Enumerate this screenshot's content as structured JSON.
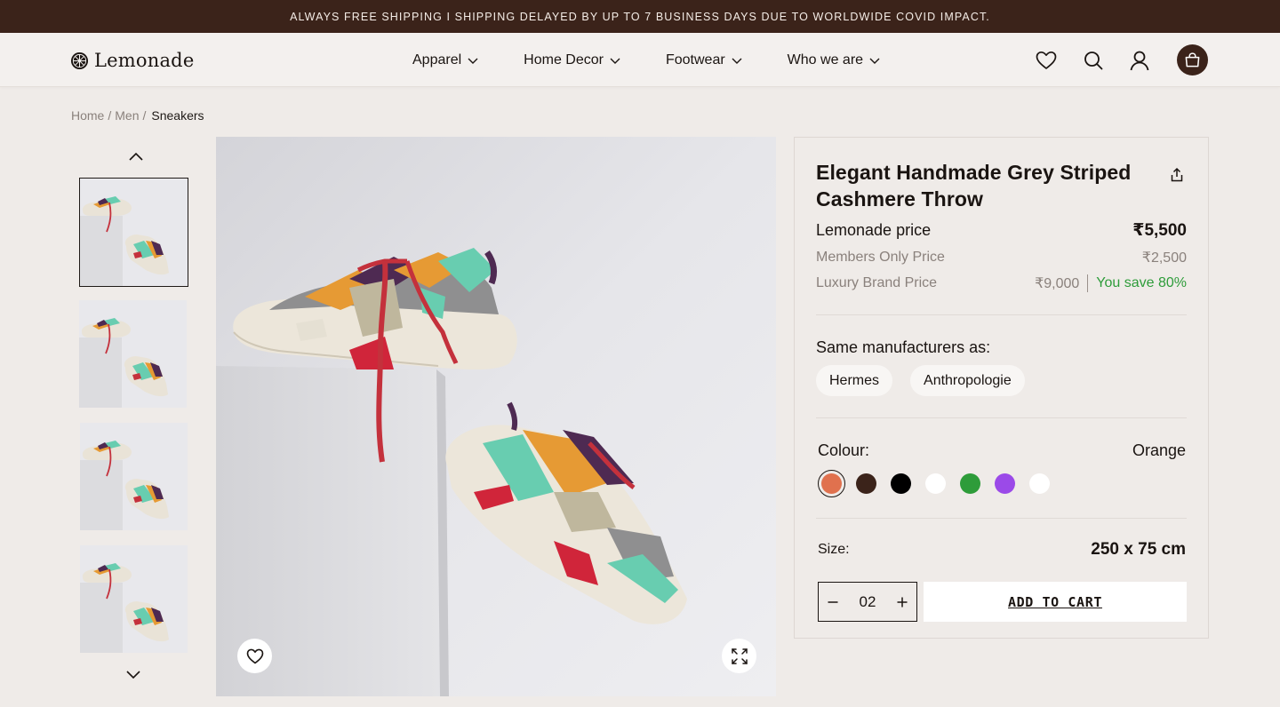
{
  "announcement": "ALWAYS FREE SHIPPING I SHIPPING DELAYED BY UP TO 7 BUSINESS DAYS DUE TO WORLDWIDE COVID IMPACT.",
  "header": {
    "logo_text": "Lemonade",
    "nav": [
      {
        "label": "Apparel"
      },
      {
        "label": "Home Decor"
      },
      {
        "label": "Footwear"
      },
      {
        "label": "Who we are"
      }
    ],
    "icons": [
      "heart-icon",
      "search-icon",
      "user-icon",
      "cart-icon"
    ]
  },
  "breadcrumb": {
    "items": [
      "Home",
      "Men"
    ],
    "current": "Sneakers"
  },
  "gallery": {
    "thumbnail_count": 4,
    "active_index": 0
  },
  "product": {
    "title": "Elegant Handmade Grey Striped Cashmere Throw",
    "prices": {
      "lemonade_label": "Lemonade price",
      "lemonade_value": "₹5,500",
      "members_label": "Members Only Price",
      "members_value": "₹2,500",
      "luxury_label": "Luxury Brand Price",
      "luxury_value": "₹9,000",
      "savings": "You save 80%"
    },
    "manufacturers_label": "Same manufacturers as:",
    "manufacturers": [
      "Hermes",
      "Anthropologie"
    ],
    "colour_label": "Colour:",
    "colour_value": "Orange",
    "colours": [
      "#e0714e",
      "#3b231a",
      "#000000",
      "#ffffff",
      "#2e9c3a",
      "#9b4ae8",
      "#ffffff"
    ],
    "selected_colour_index": 0,
    "size_label": "Size:",
    "size_value": "250 x 75 cm",
    "quantity": "02",
    "add_to_cart": "ADD TO CART"
  },
  "colors": {
    "brand_dark": "#3b231a",
    "background": "#efebe8",
    "save_green": "#2e9c3a"
  }
}
